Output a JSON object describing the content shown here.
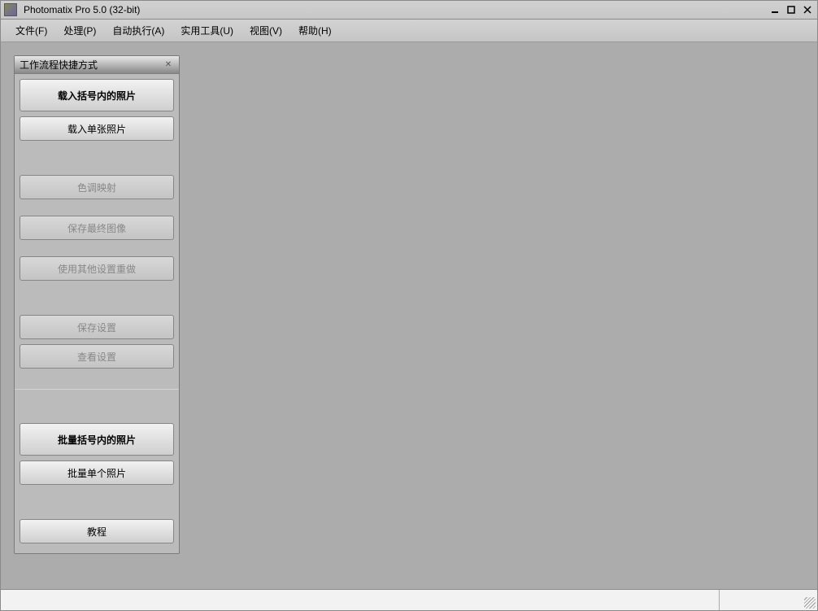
{
  "title": "Photomatix Pro 5.0 (32-bit)",
  "menubar": {
    "file": "文件(F)",
    "process": "处理(P)",
    "automate": "自动执行(A)",
    "utilities": "实用工具(U)",
    "view": "视图(V)",
    "help": "帮助(H)"
  },
  "panel": {
    "title": "工作流程快捷方式",
    "close_glyph": "✕",
    "load_bracketed": "载入括号内的照片",
    "load_single": "载入单张照片",
    "tone_mapping": "色调映射",
    "save_final": "保存最终图像",
    "redo_other_settings": "使用其他设置重做",
    "save_settings": "保存设置",
    "view_settings": "查看设置",
    "batch_bracketed": "批量括号内的照片",
    "batch_single": "批量单个照片",
    "tutorial": "教程"
  }
}
